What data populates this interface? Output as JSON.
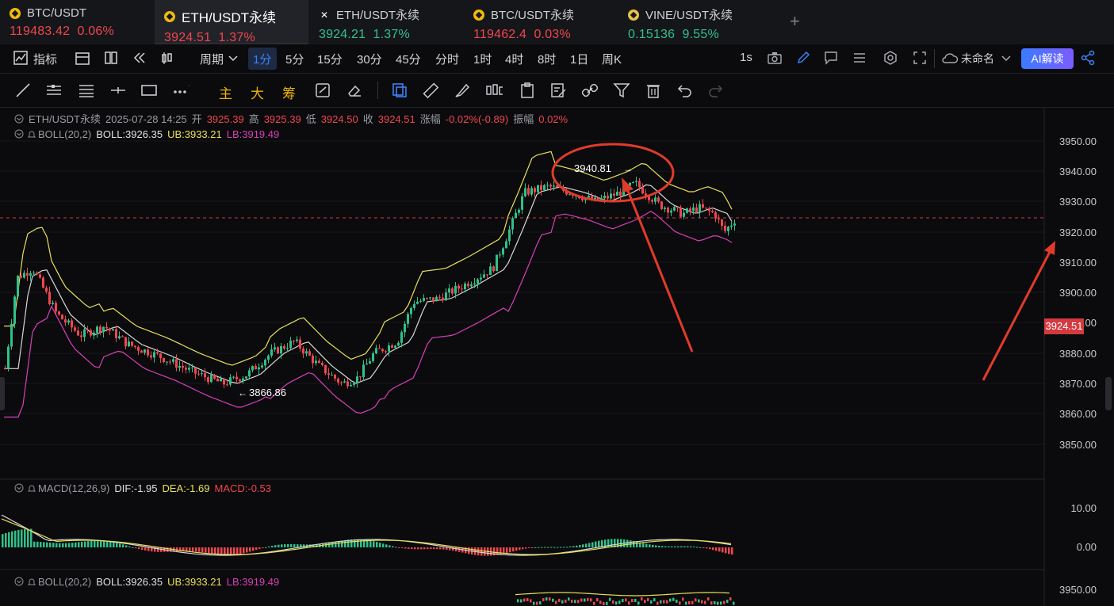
{
  "tabs": [
    {
      "name": "BTC/USDT",
      "price": "119483.42",
      "change": "0.06%",
      "color": "red",
      "icon": "binance-coin-icon"
    },
    {
      "name": "ETH/USDT永续",
      "price": "3924.51",
      "change": "1.37%",
      "color": "red",
      "icon": "binance-coin-icon"
    },
    {
      "name": "ETH/USDT永续",
      "price": "3924.21",
      "change": "1.37%",
      "color": "green",
      "icon": "x-exchange-icon"
    },
    {
      "name": "BTC/USDT永续",
      "price": "119462.4",
      "change": "0.03%",
      "color": "red",
      "icon": "binance-coin-icon"
    },
    {
      "name": "VINE/USDT永续",
      "price": "0.15136",
      "change": "9.55%",
      "color": "green",
      "icon": "vine-coin-icon"
    }
  ],
  "toolbar": {
    "indicators": "指标",
    "period": "周期",
    "intervals": [
      "1分",
      "5分",
      "15分",
      "30分",
      "45分",
      "分时",
      "1时",
      "4时",
      "8时",
      "1日",
      "周K"
    ],
    "selected_interval": "1分",
    "speed": "1s",
    "layout_name": "未命名",
    "ai_button": "AI解读"
  },
  "draw_tools": {
    "main": "主",
    "big": "大",
    "chip": "筹"
  },
  "info": {
    "symbol": "ETH/USDT永续",
    "datetime": "2025-07-28 14:25",
    "open_label": "开",
    "open": "3925.39",
    "high_label": "高",
    "high": "3925.39",
    "low_label": "低",
    "low": "3924.50",
    "close_label": "收",
    "close": "3924.51",
    "chg_label": "涨幅",
    "chg": "-0.02%(-0.89)",
    "amp_label": "振幅",
    "amp": "0.02%"
  },
  "boll": {
    "label": "BOLL(20,2)",
    "boll": "BOLL:3926.35",
    "ub": "UB:3933.21",
    "lb": "LB:3919.49"
  },
  "macd": {
    "label": "MACD(12,26,9)",
    "dif": "DIF:-1.95",
    "dea": "DEA:-1.69",
    "macd": "MACD:-0.53"
  },
  "boll2": {
    "label": "BOLL(20,2)",
    "boll": "BOLL:3926.35",
    "ub": "UB:3933.21",
    "lb": "LB:3919.49"
  },
  "price_axis": [
    "3950.00",
    "3940.00",
    "3930.00",
    "3920.00",
    "3910.00",
    "3900.00",
    "3890.00",
    "3880.00",
    "3870.00",
    "3860.00",
    "3850.00"
  ],
  "macd_axis": [
    "10.00",
    "0.00"
  ],
  "bottom_axis": [
    "3950.00"
  ],
  "current_price": "3924.51",
  "annotations": {
    "high": "3940.81",
    "low": "3866.86"
  },
  "colors": {
    "up": "#30c18a",
    "down": "#f0464f",
    "ub": "#e8e05a",
    "mid": "#d8d8d8",
    "lb": "#d93fb7",
    "accent": "#3b82f6",
    "arrow": "#e23b2a"
  }
}
